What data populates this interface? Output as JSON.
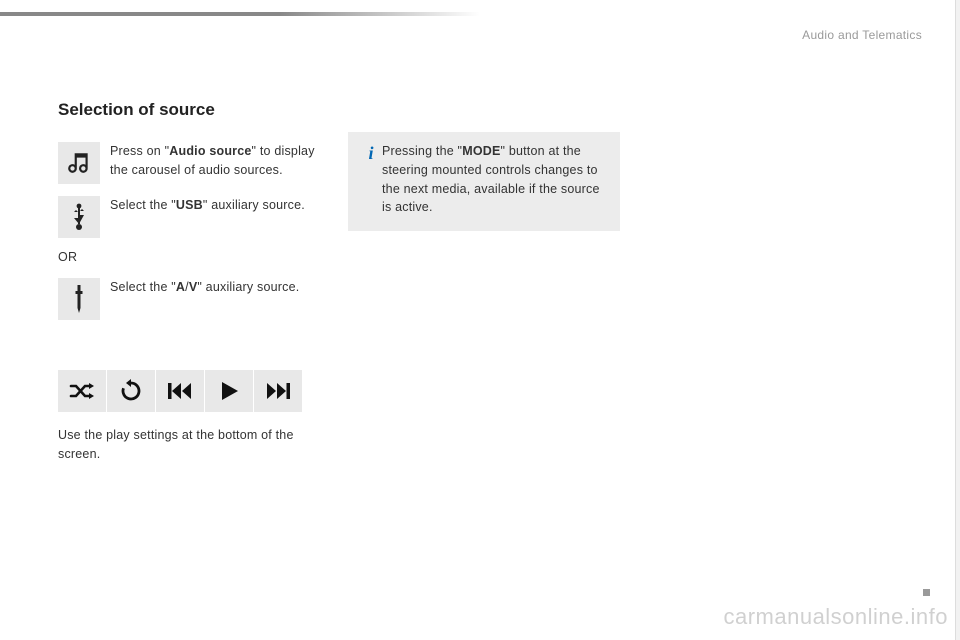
{
  "section_label": "Audio and Telematics",
  "title": "Selection of source",
  "steps": {
    "audio_source": {
      "pre": "Press on \"",
      "bold": "Audio source",
      "post": "\" to display the carousel of audio sources."
    },
    "usb": {
      "pre": "Select the \"",
      "bold": "USB",
      "post": "\" auxiliary source."
    },
    "or": "OR",
    "av": {
      "pre": "Select the \"",
      "bold1": "A",
      "mid": "/",
      "bold2": "V",
      "post": "\" auxiliary source."
    }
  },
  "bottom_text": "Use the play settings at the bottom of the screen.",
  "info": {
    "pre": "Pressing the \"",
    "bold": "MODE",
    "post": "\" button at the steering mounted controls changes to the next media, available if the source is active."
  },
  "watermark": "carmanualsonline.info",
  "icons": {
    "music": "music-note-icon",
    "usb": "usb-icon",
    "av": "aux-jack-icon",
    "shuffle": "shuffle-icon",
    "repeat": "repeat-icon",
    "prev": "previous-track-icon",
    "play": "play-icon",
    "next": "next-track-icon"
  }
}
